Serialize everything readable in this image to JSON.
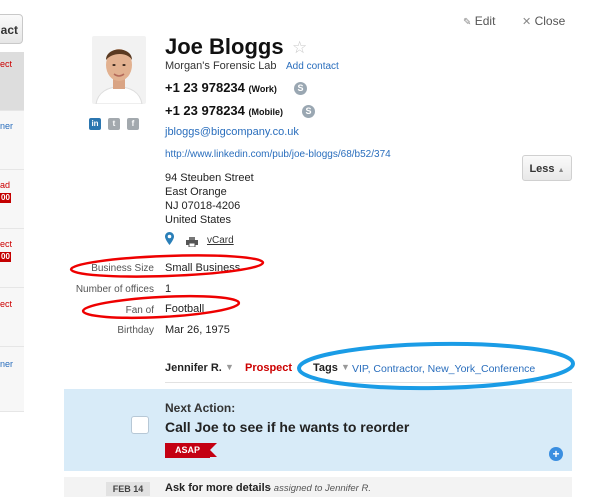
{
  "left_list": {
    "contact_button_label": "act",
    "items": [
      {
        "text": "ect",
        "color": "#c00"
      },
      {
        "text": "ner",
        "color": "#2a6ebd"
      },
      {
        "text": "ad",
        "color": "#c00",
        "badge": "00"
      },
      {
        "text": "ect",
        "color": "#c00",
        "badge": "00"
      },
      {
        "text": "ect",
        "color": "#c00"
      },
      {
        "text": "ner",
        "color": "#2a6ebd"
      }
    ]
  },
  "header": {
    "edit_label": "Edit",
    "close_label": "Close"
  },
  "contact": {
    "name": "Joe Bloggs",
    "company": "Morgan's Forensic Lab",
    "add_contact_label": "Add contact",
    "phones": [
      {
        "number": "+1 23 978234",
        "type": "(Work)"
      },
      {
        "number": "+1 23 978234",
        "type": "(Mobile)"
      }
    ],
    "email": "jbloggs@bigcompany.co.uk",
    "linkedin_url": "http://www.linkedin.com/pub/joe-bloggs/68/b52/374",
    "address_lines": [
      "94 Steuben Street",
      "East Orange",
      "NJ 07018-4206",
      "United States"
    ],
    "vcard_label": "vCard",
    "social_icons": [
      {
        "name": "linkedin-icon",
        "glyph": "in",
        "color": "#2b76b0"
      },
      {
        "name": "twitter-icon",
        "glyph": "t",
        "color": "#9aa0a6"
      },
      {
        "name": "facebook-icon",
        "glyph": "f",
        "color": "#9aa0a6"
      }
    ]
  },
  "less_button_label": "Less",
  "fields": [
    {
      "label": "Business Size",
      "value": "Small Business"
    },
    {
      "label": "Number of offices",
      "value": "1"
    },
    {
      "label": "Fan of",
      "value": "Football"
    },
    {
      "label": "Birthday",
      "value": "Mar 26, 1975"
    }
  ],
  "footer_bar": {
    "owner": "Jennifer R.",
    "status": "Prospect",
    "tags_label": "Tags",
    "tags": "VIP, Contractor, New_York_Conference"
  },
  "next_action": {
    "heading": "Next Action:",
    "title": "Call Joe to see if he wants to reorder",
    "priority": "ASAP"
  },
  "task": {
    "date": "FEB 14",
    "text": "Ask for more details",
    "assigned": "- assigned to Jennifer R."
  },
  "colors": {
    "accent_blue": "#2a6ebd",
    "prospect_red": "#cc0000",
    "action_bg": "#d8ebf8",
    "annotation_red": "#ee0000",
    "annotation_blue": "#1a9ce6"
  }
}
